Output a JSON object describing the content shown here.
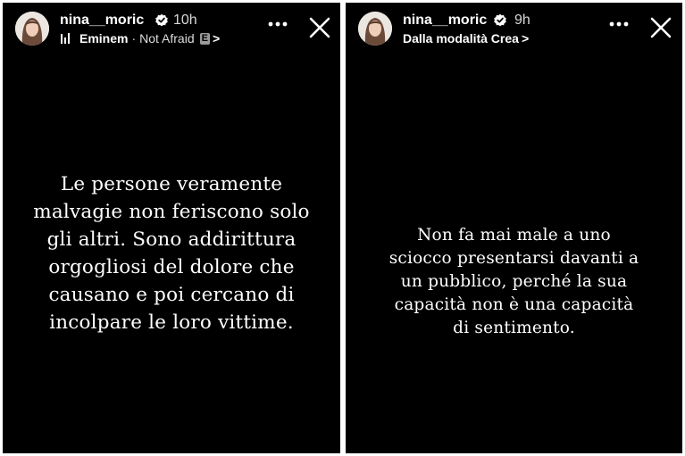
{
  "stories": [
    {
      "username": "nina__moric",
      "time": "10h",
      "music": {
        "artist": "Eminem",
        "separator": "·",
        "song": "Not Afraid",
        "explicit_badge": "E",
        "chevron": ">"
      },
      "quote_lines": [
        "Le persone veramente",
        "malvagie non feriscono solo",
        "gli altri. Sono addirittura",
        "orgogliosi del dolore che",
        "causano e poi cercano di",
        "incolpare le loro vittime."
      ]
    },
    {
      "username": "nina__moric",
      "time": "9h",
      "subtitle": "Dalla modalità Crea",
      "chevron": ">",
      "quote_lines": [
        "Non fa mai male a uno",
        "sciocco presentarsi davanti a",
        "un pubblico, perché la sua",
        "capacità non è una capacità",
        "di sentimento."
      ]
    }
  ],
  "icons": [
    "avatar",
    "verified-badge-icon",
    "music-bars-icon",
    "more-options-icon",
    "close-icon"
  ],
  "colors": {
    "background": "#000000",
    "text": "#ffffff",
    "frame": "#ffffff"
  }
}
